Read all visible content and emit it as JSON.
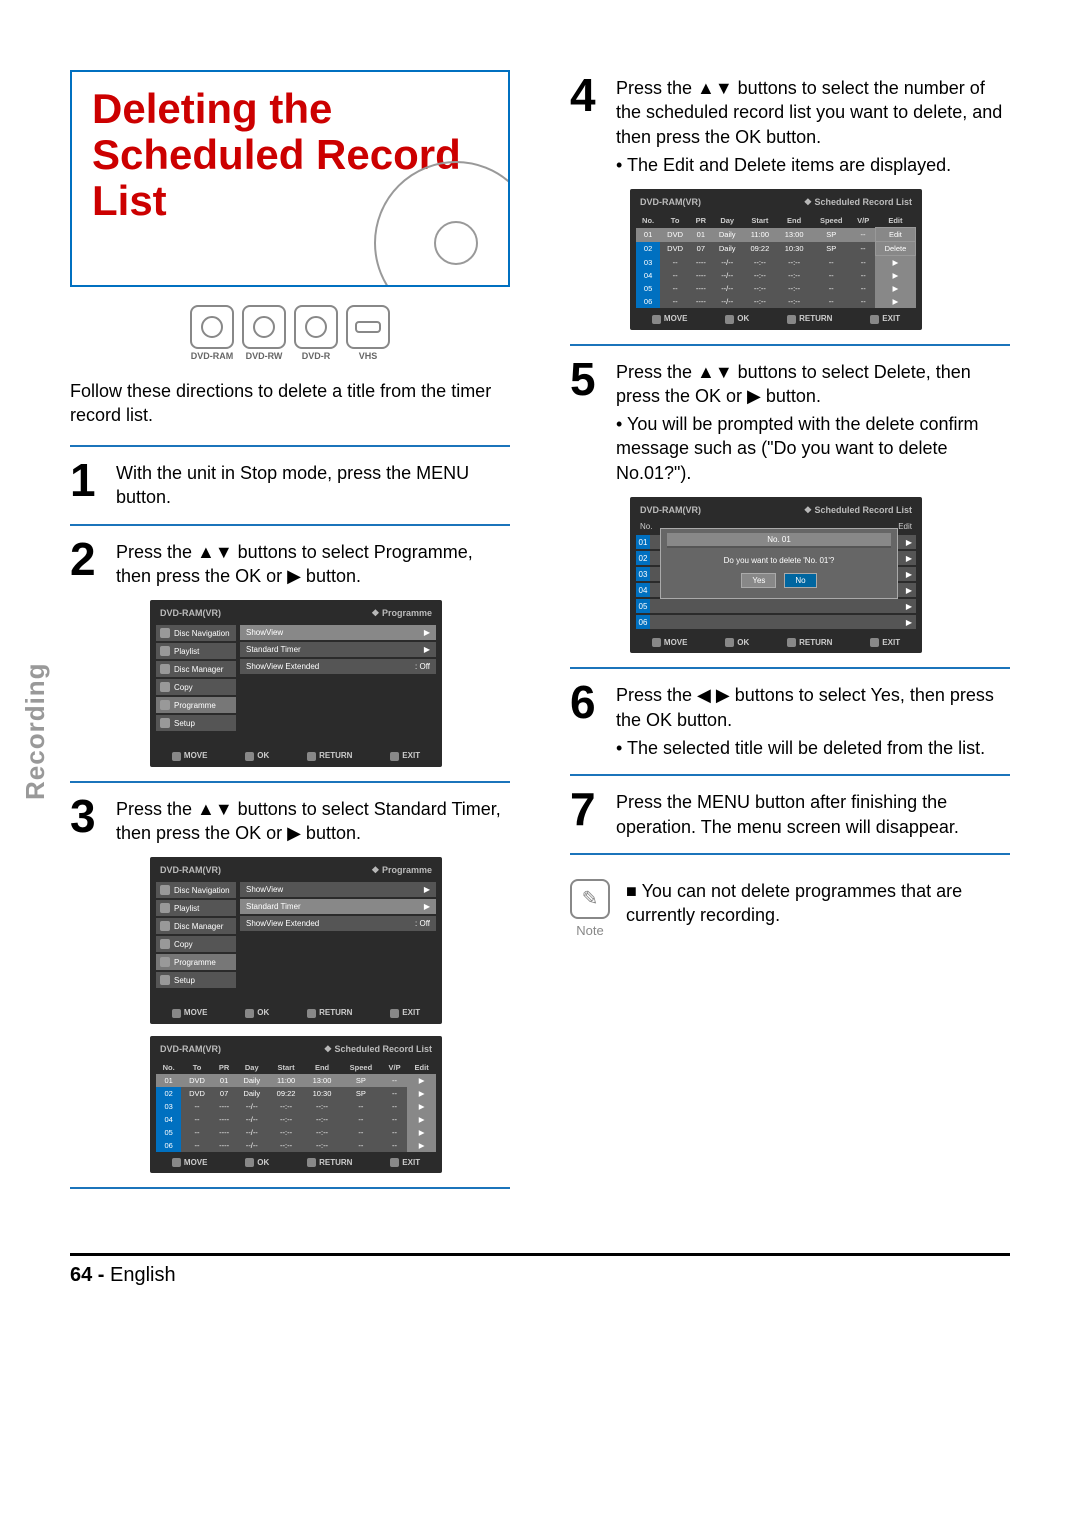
{
  "sideLabel": "Recording",
  "title": "Deleting the Scheduled Record List",
  "media": [
    "DVD-RAM",
    "DVD-RW",
    "DVD-R",
    "VHS"
  ],
  "intro": "Follow these directions to delete a title from the timer record list.",
  "steps": {
    "s1": "With the unit in Stop mode, press the MENU button.",
    "s2": "Press the ▲▼ buttons to select Programme, then press the OK or ▶ button.",
    "s3": "Press the ▲▼ buttons to select Standard Timer, then press the OK or ▶ button.",
    "s4_a": "Press the ▲▼ buttons to select the number of the scheduled record list you want to delete, and then press the OK button.",
    "s4_b": "• The Edit and Delete items are displayed.",
    "s5_a": "Press the ▲▼  buttons to select Delete, then press the OK or ▶ button.",
    "s5_b": "• You will be prompted with the delete confirm message such as (\"Do you want to delete No.01?\").",
    "s6_a": "Press the ◀ ▶ buttons to select Yes, then press the OK button.",
    "s6_b": "• The selected title will be deleted from the list.",
    "s7": "Press the MENU button after finishing the operation. The menu screen will disappear."
  },
  "note": {
    "label": "Note",
    "text": "You can not delete programmes that are currently recording."
  },
  "osd": {
    "dvd": "DVD-RAM(VR)",
    "prog_title": "❖ Programme",
    "sched_title": "❖   Scheduled Record List",
    "left_menu": [
      "Disc Navigation",
      "Playlist",
      "Disc Manager",
      "Copy",
      "Programme",
      "Setup"
    ],
    "right_menu": {
      "sv": "ShowView",
      "st": "Standard Timer",
      "sve": "ShowView Extended",
      "sve_val": ": Off"
    },
    "footer": {
      "move": "MOVE",
      "ok": "OK",
      "return": "RETURN",
      "exit": "EXIT"
    },
    "table": {
      "head": [
        "No.",
        "To",
        "PR",
        "Day",
        "Start",
        "End",
        "Speed",
        "V/P",
        "Edit"
      ],
      "rows": [
        [
          "01",
          "DVD",
          "01",
          "Daily",
          "11:00",
          "13:00",
          "SP",
          "--",
          "▶"
        ],
        [
          "02",
          "DVD",
          "07",
          "Daily",
          "09:22",
          "10:30",
          "SP",
          "--",
          "▶"
        ],
        [
          "03",
          "--",
          "----",
          "--/--",
          "--:--",
          "--:--",
          "--",
          "--",
          "▶"
        ],
        [
          "04",
          "--",
          "----",
          "--/--",
          "--:--",
          "--:--",
          "--",
          "--",
          "▶"
        ],
        [
          "05",
          "--",
          "----",
          "--/--",
          "--:--",
          "--:--",
          "--",
          "--",
          "▶"
        ],
        [
          "06",
          "--",
          "----",
          "--/--",
          "--:--",
          "--:--",
          "--",
          "--",
          "▶"
        ]
      ],
      "edit_labels": {
        "edit": "Edit",
        "delete": "Delete"
      }
    },
    "dialog": {
      "title": "No. 01",
      "msg": "Do you want to delete 'No. 01'?",
      "yes": "Yes",
      "no": "No",
      "side_no": "No.",
      "side_edit": "Edit"
    }
  },
  "footer": {
    "page": "64 -",
    "lang": "English"
  }
}
